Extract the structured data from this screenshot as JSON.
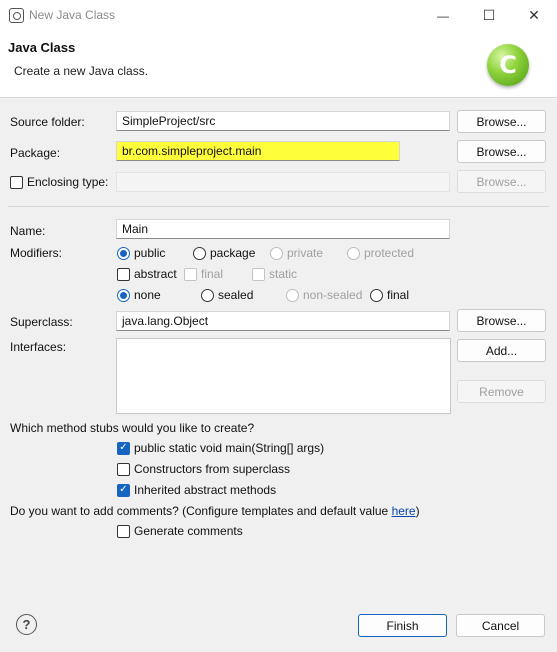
{
  "window": {
    "title": "New Java Class",
    "minimize": "—",
    "maximize": "☐",
    "close": "✕"
  },
  "header": {
    "title": "Java Class",
    "description": "Create a new Java class."
  },
  "source_folder": {
    "label": "Source folder:",
    "value": "SimpleProject/src",
    "browse": "Browse..."
  },
  "package": {
    "label": "Package:",
    "value": "br.com.simpleproject.main",
    "browse": "Browse..."
  },
  "enclosing_type": {
    "label": "Enclosing type:",
    "value": "",
    "browse": "Browse...",
    "checked": false
  },
  "name": {
    "label": "Name:",
    "value": "Main"
  },
  "modifiers": {
    "label": "Modifiers:",
    "access": [
      "public",
      "package",
      "private",
      "protected"
    ],
    "access_selected": "public",
    "flags": [
      "abstract",
      "final",
      "static"
    ],
    "sealing": [
      "none",
      "sealed",
      "non-sealed",
      "final"
    ],
    "sealing_selected": "none"
  },
  "superclass": {
    "label": "Superclass:",
    "value": "java.lang.Object",
    "browse": "Browse..."
  },
  "interfaces": {
    "label": "Interfaces:",
    "add": "Add...",
    "remove": "Remove"
  },
  "stubs": {
    "question": "Which method stubs would you like to create?",
    "items": [
      {
        "label": "public static void main(String[] args)",
        "checked": true
      },
      {
        "label": "Constructors from superclass",
        "checked": false
      },
      {
        "label": "Inherited abstract methods",
        "checked": true
      }
    ]
  },
  "comments": {
    "question_prefix": "Do you want to add comments? (Configure templates and default value ",
    "link": "here",
    "question_suffix": ")",
    "generate": "Generate comments",
    "checked": false
  },
  "footer": {
    "help": "?",
    "finish": "Finish",
    "cancel": "Cancel"
  },
  "colors": {
    "accent": "#1565c0",
    "highlight": "#fefe3a"
  }
}
